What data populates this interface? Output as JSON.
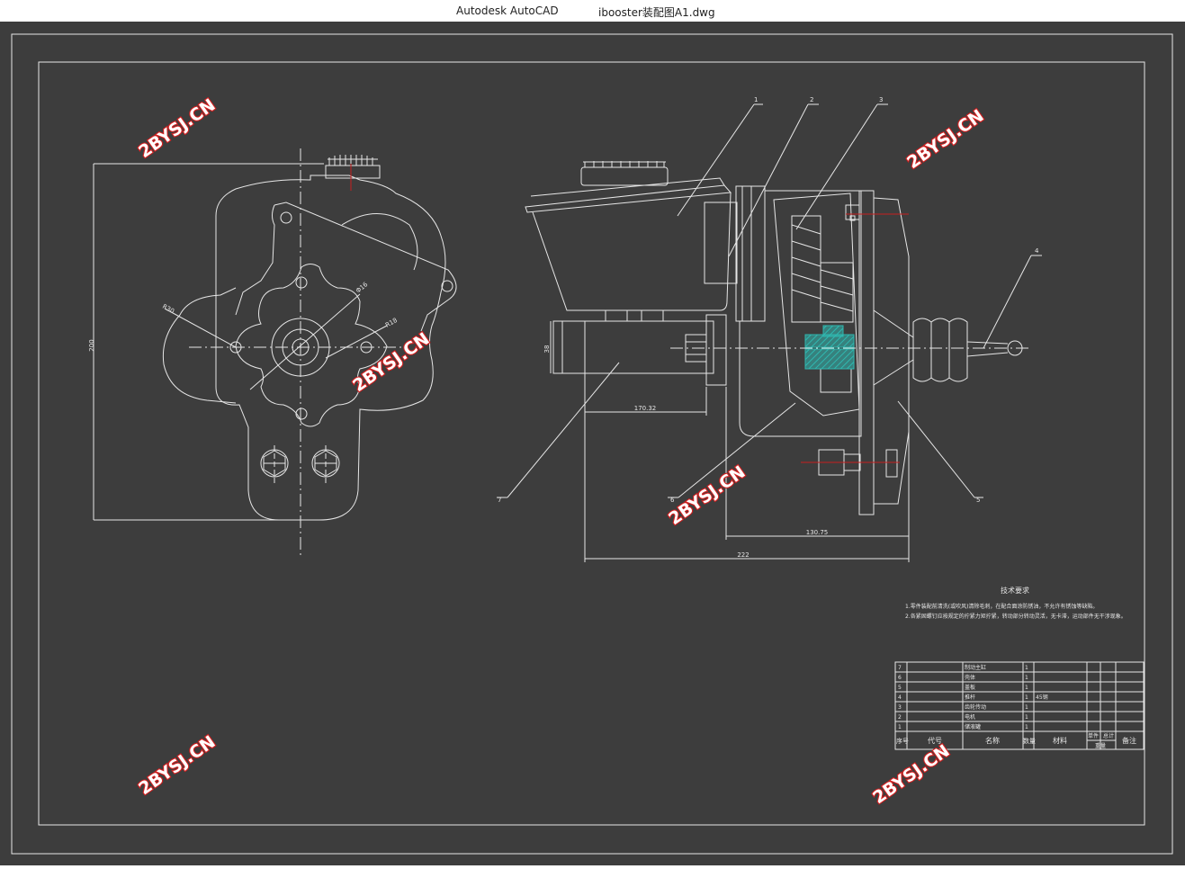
{
  "window": {
    "app_name": "Autodesk AutoCAD",
    "file_name": "ibooster装配图A1.dwg"
  },
  "drawing": {
    "balloons": [
      "1",
      "2",
      "3",
      "4",
      "5",
      "6",
      "7"
    ],
    "dimensions": {
      "front_height": "200",
      "radius_1": "R30",
      "diameter": "Φ16",
      "radius_2": "R18",
      "side_height": "38",
      "length_1": "170.32",
      "length_2": "130.75",
      "length_3": "222"
    },
    "technical_requirements": {
      "title": "技术要求",
      "lines": [
        "1.零件装配前清洗(或吹风)清除毛刺，在配合面涂防锈油，不允许有锈蚀等缺陷。",
        "2.各紧固螺钉应按规定的拧紧力矩拧紧，转动部分转动灵活，无卡滞，运动部件无干涉现象。"
      ]
    },
    "bom": {
      "headers": [
        "序号",
        "代号",
        "名称",
        "数量",
        "材料",
        "单件",
        "总计",
        "备注"
      ],
      "weight_label": "重量",
      "rows": [
        {
          "no": "7",
          "name": "制动主缸",
          "qty": "1",
          "material": ""
        },
        {
          "no": "6",
          "name": "壳体",
          "qty": "1",
          "material": ""
        },
        {
          "no": "5",
          "name": "盖板",
          "qty": "1",
          "material": ""
        },
        {
          "no": "4",
          "name": "推杆",
          "qty": "1",
          "material": "45钢"
        },
        {
          "no": "3",
          "name": "齿轮传动",
          "qty": "1",
          "material": ""
        },
        {
          "no": "2",
          "name": "电机",
          "qty": "1",
          "material": ""
        },
        {
          "no": "1",
          "name": "储液罐",
          "qty": "1",
          "material": ""
        }
      ]
    },
    "watermark": "2BYSJ.CN"
  },
  "colors": {
    "background": "#3d3d3d",
    "lines": "#e6e6e6",
    "centerline_red": "#c81e1e",
    "hatch_cyan": "#2fb8b0",
    "watermark_stroke": "#d41f1f"
  }
}
